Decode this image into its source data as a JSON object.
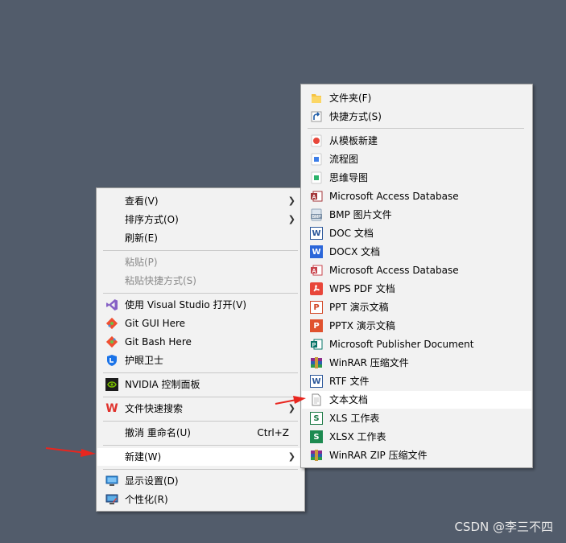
{
  "context_menu": {
    "items": [
      {
        "label": "查看(V)"
      },
      {
        "label": "排序方式(O)"
      },
      {
        "label": "刷新(E)"
      },
      {
        "label": "粘贴(P)"
      },
      {
        "label": "粘贴快捷方式(S)"
      },
      {
        "label": "使用 Visual Studio 打开(V)"
      },
      {
        "label": "Git GUI Here"
      },
      {
        "label": "Git Bash Here"
      },
      {
        "label": "护眼卫士"
      },
      {
        "label": "NVIDIA 控制面板"
      },
      {
        "label": "文件快速搜索"
      },
      {
        "label": "撤消 重命名(U)",
        "shortcut": "Ctrl+Z"
      },
      {
        "label": "新建(W)"
      },
      {
        "label": "显示设置(D)"
      },
      {
        "label": "个性化(R)"
      }
    ]
  },
  "new_submenu": {
    "items": [
      {
        "label": "文件夹(F)"
      },
      {
        "label": "快捷方式(S)"
      },
      {
        "label": "从模板新建"
      },
      {
        "label": "流程图"
      },
      {
        "label": "思维导图"
      },
      {
        "label": "Microsoft Access Database"
      },
      {
        "label": "BMP 图片文件"
      },
      {
        "label": "DOC 文档"
      },
      {
        "label": "DOCX 文档"
      },
      {
        "label": "Microsoft Access Database"
      },
      {
        "label": "WPS PDF 文档"
      },
      {
        "label": "PPT 演示文稿"
      },
      {
        "label": "PPTX 演示文稿"
      },
      {
        "label": "Microsoft Publisher Document"
      },
      {
        "label": "WinRAR 压缩文件"
      },
      {
        "label": "RTF 文件"
      },
      {
        "label": "文本文档"
      },
      {
        "label": "XLS 工作表"
      },
      {
        "label": "XLSX 工作表"
      },
      {
        "label": "WinRAR ZIP 压缩文件"
      }
    ]
  },
  "watermark": "CSDN @李三不四",
  "colors": {
    "desktop": "#525c6b",
    "menu_bg": "#f2f2f2",
    "highlight": "#ffffff",
    "arrow_red": "#e8261f"
  }
}
